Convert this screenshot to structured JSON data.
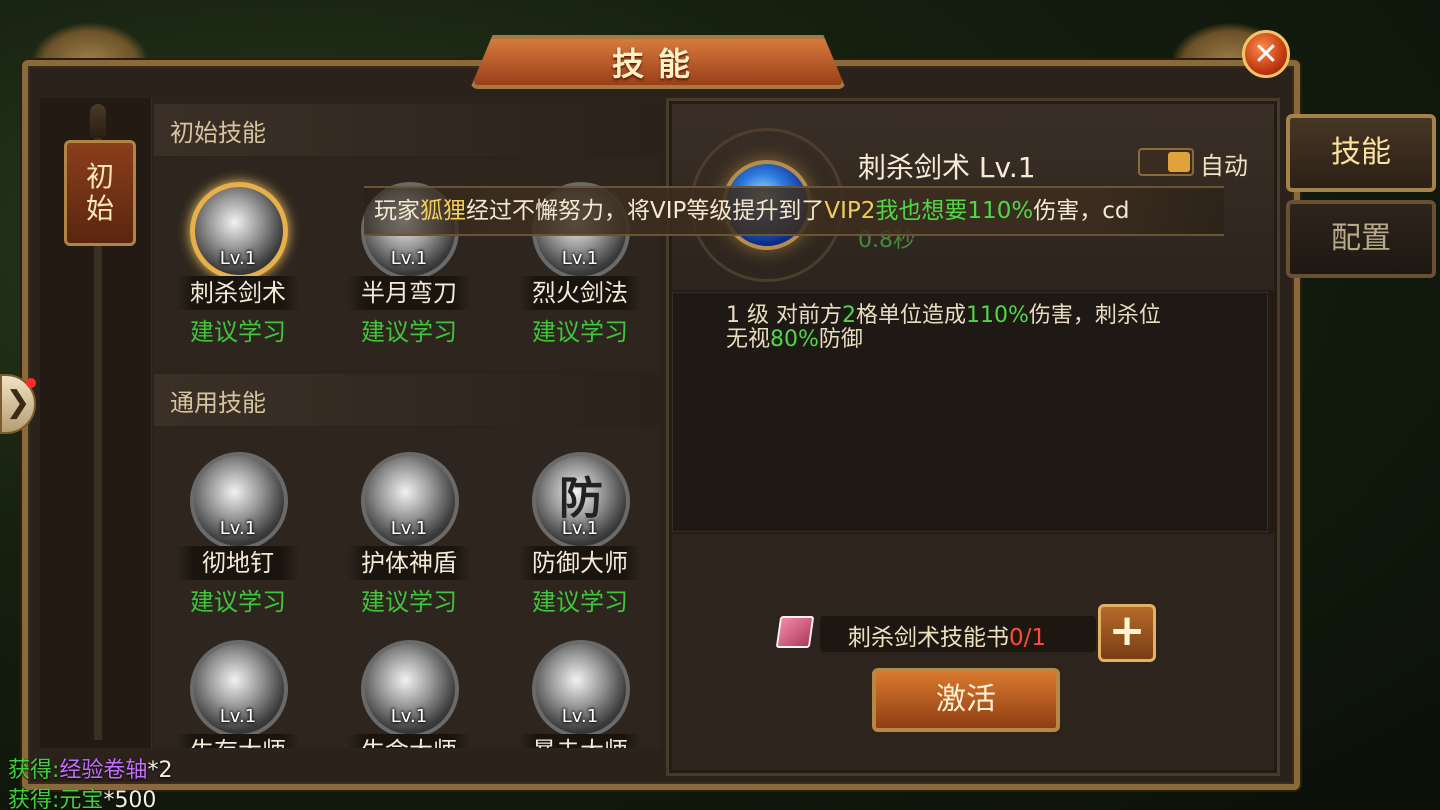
{
  "window": {
    "title": "技能",
    "close_symbol": "✕"
  },
  "rail": {
    "tag_line1": "初",
    "tag_line2": "始"
  },
  "sections": [
    {
      "title": "初始技能",
      "skills": [
        {
          "name": "刺杀剑术",
          "level": "Lv.1",
          "advice": "建议学习",
          "icon": "sword-thrust-icon"
        },
        {
          "name": "半月弯刀",
          "level": "Lv.1",
          "advice": "建议学习",
          "icon": "half-moon-blade-icon"
        },
        {
          "name": "烈火剑法",
          "level": "Lv.1",
          "advice": "建议学习",
          "icon": "fire-sword-icon"
        }
      ]
    },
    {
      "title": "通用技能",
      "skills": [
        {
          "name": "彻地钉",
          "level": "Lv.1",
          "advice": "建议学习",
          "icon": "ground-spike-icon"
        },
        {
          "name": "护体神盾",
          "level": "Lv.1",
          "advice": "建议学习",
          "icon": "shield-orb-icon"
        },
        {
          "name": "防御大师",
          "level": "Lv.1",
          "advice": "建议学习",
          "icon": "defense-master-icon"
        },
        {
          "name": "生存大师",
          "level": "Lv.1",
          "advice": "",
          "icon": "demon-icon"
        },
        {
          "name": "生命大师",
          "level": "Lv.1",
          "advice": "",
          "icon": "cross-icon"
        },
        {
          "name": "暴击大师",
          "level": "Lv.1",
          "advice": "",
          "icon": "critical-blade-icon"
        }
      ]
    }
  ],
  "defense_glyph": "防",
  "detail": {
    "skill_name": "刺杀剑术 Lv.1",
    "auto_label": "自动",
    "cd_tail": "0.8秒",
    "desc_part1": "1 级 对前方",
    "desc_num1": "2",
    "desc_part2": "格单位造成",
    "desc_pct": "110%",
    "desc_part3": "伤害，刺杀位",
    "desc_part4": "无视",
    "desc_pct2": "80%",
    "desc_part5": "防御",
    "book_label": "刺杀剑术技能书",
    "book_count": "0/1",
    "plus_label": "+",
    "activate_label": "激活"
  },
  "tabs": [
    {
      "label": "技能",
      "active": true
    },
    {
      "label": "配置",
      "active": false
    }
  ],
  "broadcast": {
    "prefix": "玩家",
    "player": "狐狸",
    "middle": "经过不懈努力，将VIP等级提升到了",
    "vip": "VIP2",
    "link": "我也想要",
    "pct": "110%",
    "tail": "伤害，cd"
  },
  "side_arrow": "❯",
  "rewards": [
    {
      "prefix": "获得:",
      "item": "经验卷轴",
      "qty": "*2",
      "item_color": "purple"
    },
    {
      "prefix": "获得:",
      "item": "元宝",
      "qty": "*500",
      "item_color": "green"
    }
  ],
  "colors": {
    "advice_green": "#3fc53a",
    "accent_gold": "#e7b04a",
    "count_red": "#ff4a3a"
  }
}
